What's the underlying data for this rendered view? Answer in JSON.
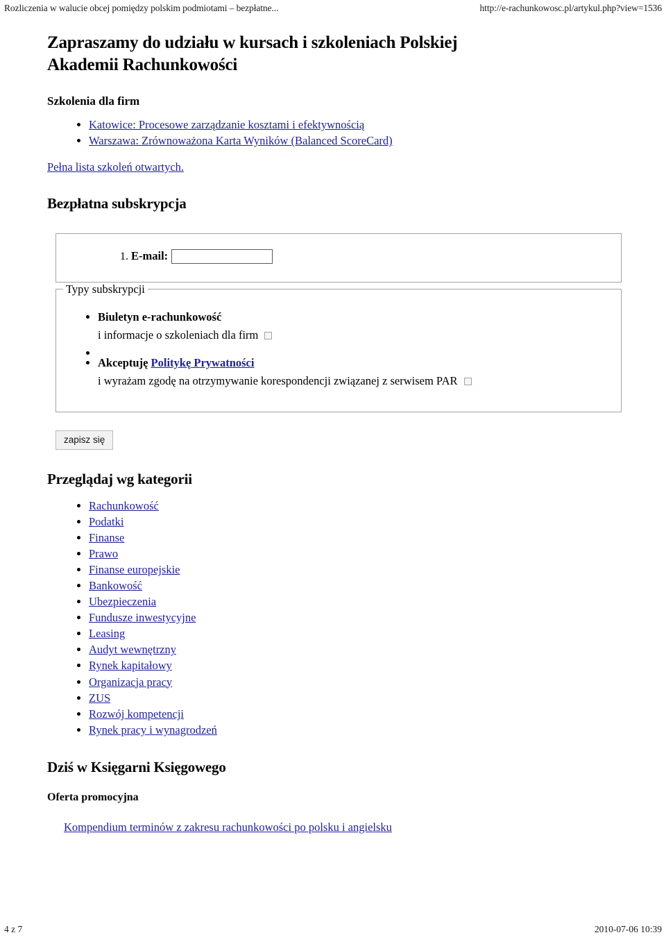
{
  "print_header": {
    "document_title": "Rozliczenia w walucie obcej pomiędzy polskim podmiotami – bezpłatne...",
    "url": "http://e-rachunkowosc.pl/artykul.php?view=1536"
  },
  "article": {
    "title": "Zapraszamy do udziału w kursach i szkoleniach Polskiej Akademii Rachunkowości",
    "training_heading": "Szkolenia dla firm",
    "training_links": [
      "Katowice: Procesowe zarządzanie kosztami i efektywnością",
      "Warszawa: Zrównoważona Karta Wyników (Balanced ScoreCard)"
    ],
    "full_list_link": "Pełna lista szkoleń otwartych."
  },
  "subscription": {
    "heading": "Bezpłatna subskrypcja",
    "email_label": "E-mail:",
    "email_value": "",
    "email_placeholder": "",
    "fieldset_legend": "Typy subskrypcji",
    "options": [
      {
        "title": "Biuletyn e-rachunkowość",
        "description": "i informacje o szkoleniach dla firm",
        "checked": false
      },
      {
        "title": "",
        "description": "",
        "checked": false
      },
      {
        "title_prefix": "Akceptuję ",
        "title_link": "Politykę Prywatności",
        "description": "i wyrażam zgodę na otrzymywanie korespondencji związanej z serwisem PAR",
        "checked": false
      }
    ],
    "submit_label": "zapisz się"
  },
  "categories": {
    "heading": "Przeglądaj wg kategorii",
    "items": [
      "Rachunkowość",
      "Podatki",
      "Finanse",
      "Prawo",
      "Finanse europejskie",
      "Bankowość",
      "Ubezpieczenia",
      "Fundusze inwestycyjne",
      "Leasing",
      "Audyt wewnętrzny",
      "Rynek kapitałowy",
      "Organizacja pracy",
      "ZUS",
      "Rozwój kompetencji",
      "Rynek pracy i wynagrodzeń"
    ]
  },
  "bookstore": {
    "heading": "Dziś w Księgarni Księgowego",
    "promo_label": "Oferta promocyjna",
    "promo_link": "Kompendium terminów z zakresu rachunkowości po polsku i angielsku"
  },
  "print_footer": {
    "page_indicator": "4 z 7",
    "timestamp": "2010-07-06 10:39"
  },
  "colors": {
    "link": "#1f1f9c",
    "text": "#000000",
    "border": "#a3a3a3",
    "button_bg": "#f2f2f2"
  }
}
